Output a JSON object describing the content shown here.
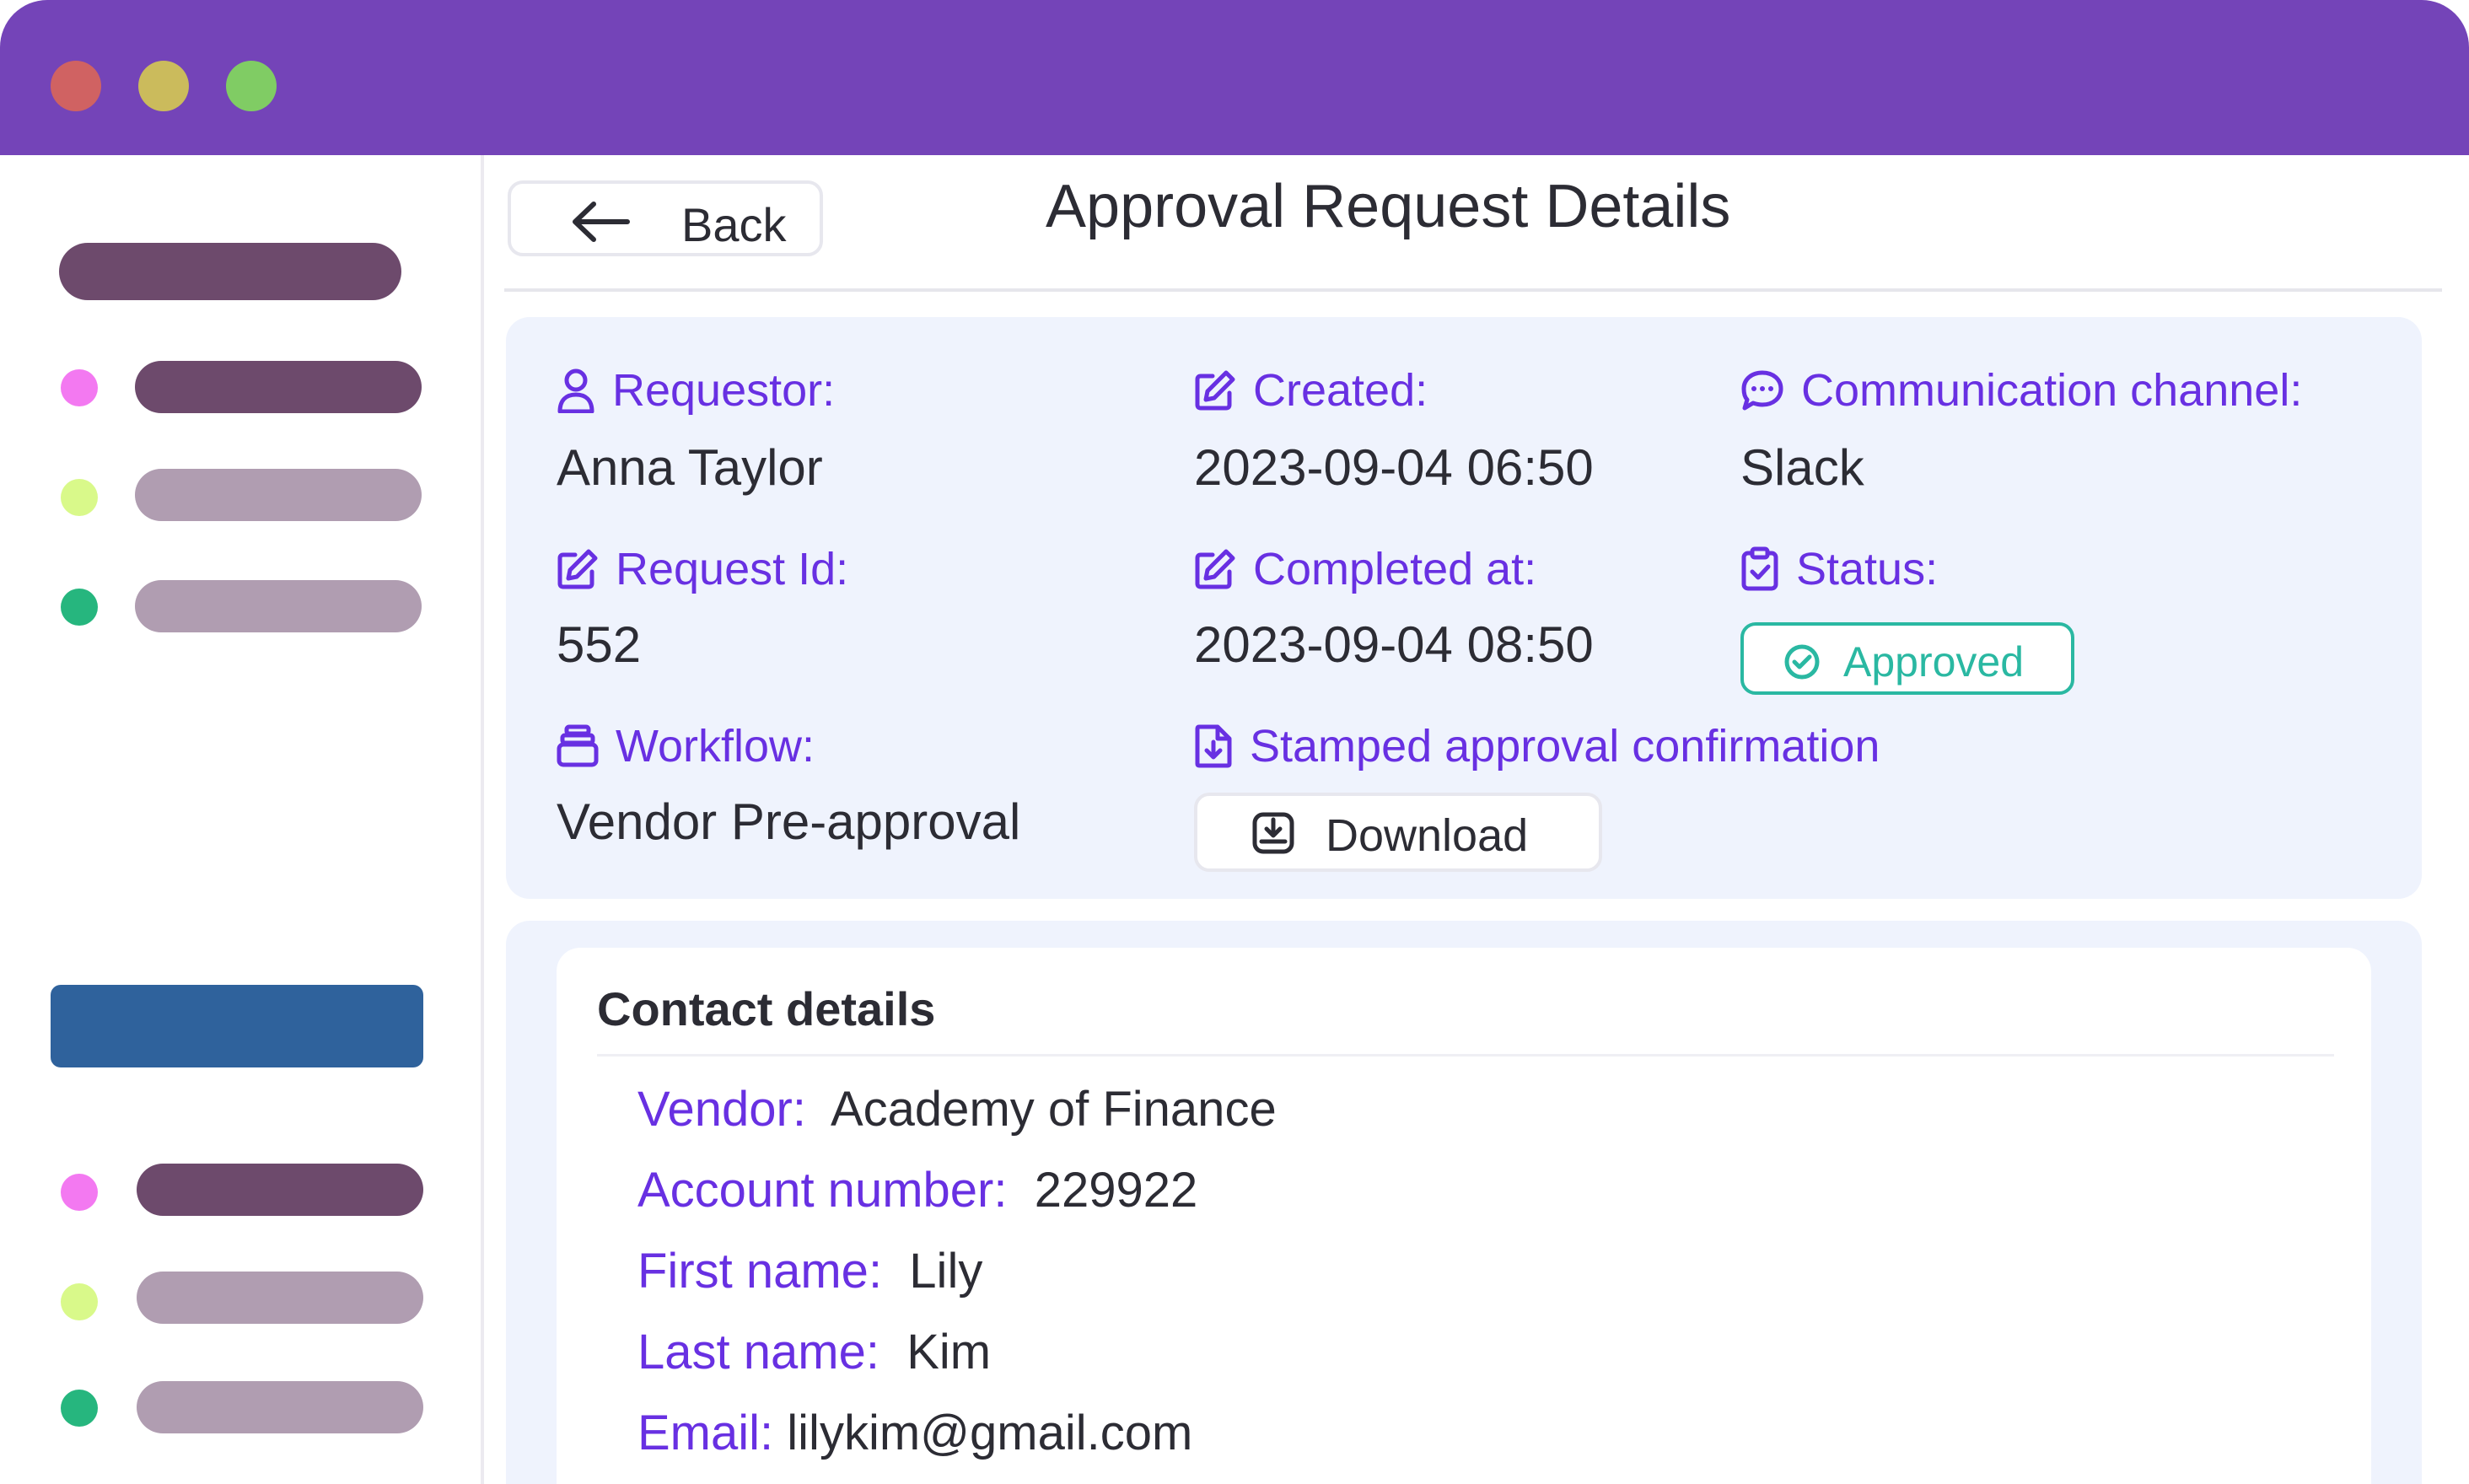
{
  "colors": {
    "titlebar": "#7444b8",
    "accent": "#6830e2",
    "approved": "#2ab8a2",
    "panel_bg": "#eff3fd"
  },
  "header": {
    "back_label": "Back",
    "title": "Approval Request Details"
  },
  "details": {
    "requestor": {
      "label": "Requestor:",
      "value": "Anna Taylor",
      "icon": "user-icon"
    },
    "created": {
      "label": "Created:",
      "value": "2023-09-04 06:50",
      "icon": "edit-icon"
    },
    "channel": {
      "label": "Communication channel:",
      "value": "Slack",
      "icon": "chat-icon"
    },
    "request_id": {
      "label": "Request Id:",
      "value": "552",
      "icon": "edit-icon"
    },
    "completed": {
      "label": "Completed at:",
      "value": "2023-09-04 08:50",
      "icon": "edit-icon"
    },
    "status": {
      "label": "Status:",
      "value": "Approved",
      "icon": "clipboard-check-icon"
    },
    "workflow": {
      "label": "Workflow:",
      "value": "Vendor Pre-approval",
      "icon": "stack-icon"
    },
    "stamped": {
      "label": "Stamped approval confirmation",
      "icon": "file-download-icon"
    },
    "download_label": "Download"
  },
  "contact": {
    "title": "Contact details",
    "rows": [
      {
        "label": "Vendor:",
        "value": "Academy of Finance"
      },
      {
        "label": "Account number:",
        "value": "229922"
      },
      {
        "label": "First name:",
        "value": "Lily"
      },
      {
        "label": "Last name:",
        "value": "Kim"
      },
      {
        "label": "Email:",
        "value": "lilykim@gmail.com"
      }
    ]
  }
}
